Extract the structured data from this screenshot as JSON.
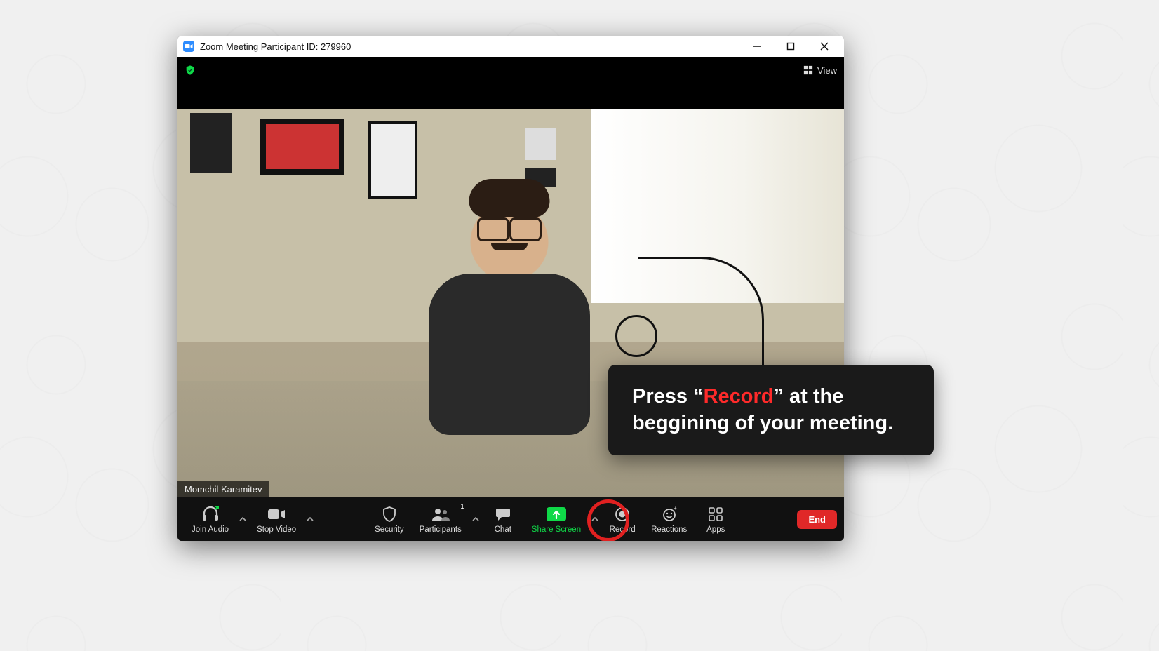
{
  "titlebar": {
    "title": "Zoom Meeting Participant ID: 279960"
  },
  "topbar": {
    "view_label": "View"
  },
  "participant_name": "Momchil Karamitev",
  "callout": {
    "prefix": "Press “",
    "highlight": "Record",
    "suffix": "” at the beggining of your meeting."
  },
  "toolbar": {
    "join_audio": "Join Audio",
    "stop_video": "Stop Video",
    "security": "Security",
    "participants": "Participants",
    "participants_count": "1",
    "chat": "Chat",
    "share_screen": "Share Screen",
    "record": "Record",
    "reactions": "Reactions",
    "apps": "Apps",
    "end": "End"
  }
}
